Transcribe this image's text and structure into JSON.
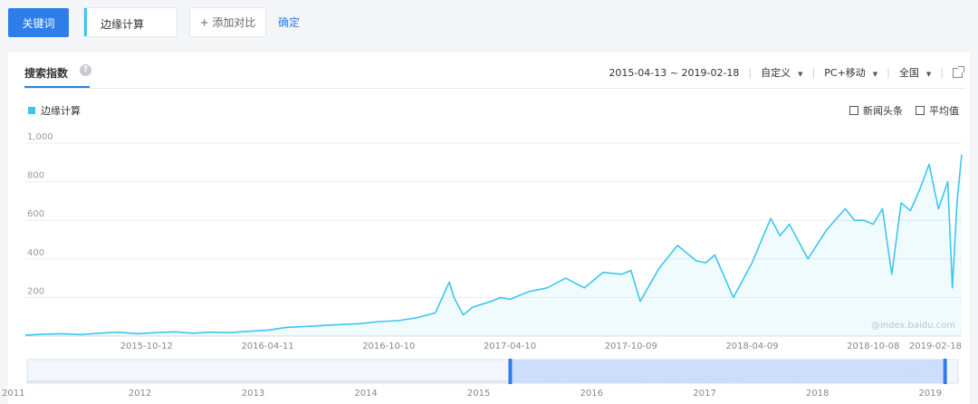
{
  "toolbar": {
    "keyword_button": "关键词",
    "keyword_value": "边缘计算",
    "add_compare": "+ 添加对比",
    "confirm": "确定"
  },
  "panel": {
    "tab_title": "搜索指数",
    "help_icon": "question-icon",
    "date_range": "2015-04-13 ~ 2019-02-18",
    "mode": "自定义",
    "device": "PC+移动",
    "region": "全国",
    "external_icon": "external-link-icon"
  },
  "options": {
    "news": "新闻头条",
    "average": "平均值"
  },
  "watermark": "@index.baidu.com",
  "colors": {
    "accent": "#2d7ee8",
    "series": "#3cc6ef",
    "range_fill": "#c9dcfa"
  },
  "chart_data": {
    "type": "area",
    "title": "",
    "xlabel": "",
    "ylabel": "",
    "ylim": [
      0,
      1000
    ],
    "yticks": [
      "1,000",
      "800",
      "600",
      "400",
      "200"
    ],
    "xtick_labels": [
      "2015-10-12",
      "2016-04-11",
      "2016-10-10",
      "2017-04-10",
      "2017-10-09",
      "2018-04-09",
      "2018-10-08",
      "2019-02-18"
    ],
    "legend": [
      "边缘计算"
    ],
    "grid": true,
    "series": [
      {
        "name": "边缘计算",
        "x": [
          "2015-04-13",
          "2015-05-11",
          "2015-06-08",
          "2015-07-06",
          "2015-08-03",
          "2015-08-31",
          "2015-09-28",
          "2015-10-26",
          "2015-11-23",
          "2015-12-21",
          "2016-01-18",
          "2016-02-15",
          "2016-03-14",
          "2016-04-11",
          "2016-05-09",
          "2016-06-06",
          "2016-07-04",
          "2016-08-01",
          "2016-08-29",
          "2016-09-26",
          "2016-10-24",
          "2016-11-21",
          "2016-12-19",
          "2017-01-09",
          "2017-01-16",
          "2017-01-30",
          "2017-02-13",
          "2017-03-13",
          "2017-03-27",
          "2017-04-10",
          "2017-05-08",
          "2017-06-05",
          "2017-07-03",
          "2017-07-31",
          "2017-08-28",
          "2017-09-25",
          "2017-10-09",
          "2017-10-23",
          "2017-11-20",
          "2017-12-18",
          "2018-01-15",
          "2018-01-29",
          "2018-02-12",
          "2018-03-12",
          "2018-04-09",
          "2018-05-07",
          "2018-05-21",
          "2018-06-04",
          "2018-07-02",
          "2018-07-30",
          "2018-08-27",
          "2018-09-10",
          "2018-09-24",
          "2018-10-08",
          "2018-10-22",
          "2018-11-05",
          "2018-11-19",
          "2018-12-03",
          "2018-12-17",
          "2018-12-31",
          "2019-01-14",
          "2019-01-28",
          "2019-02-04",
          "2019-02-11",
          "2019-02-18"
        ],
        "values": [
          5,
          10,
          12,
          8,
          15,
          20,
          12,
          18,
          22,
          15,
          20,
          18,
          25,
          30,
          45,
          50,
          55,
          60,
          65,
          75,
          80,
          95,
          120,
          280,
          200,
          110,
          150,
          180,
          200,
          190,
          230,
          250,
          300,
          250,
          330,
          320,
          340,
          180,
          350,
          470,
          390,
          380,
          420,
          200,
          380,
          610,
          520,
          580,
          400,
          550,
          660,
          600,
          600,
          580,
          660,
          320,
          690,
          650,
          760,
          890,
          660,
          800,
          250,
          700,
          940
        ]
      }
    ]
  },
  "overview": {
    "years": [
      "2011",
      "2012",
      "2013",
      "2014",
      "2015",
      "2016",
      "2017",
      "2018",
      "2019"
    ]
  }
}
